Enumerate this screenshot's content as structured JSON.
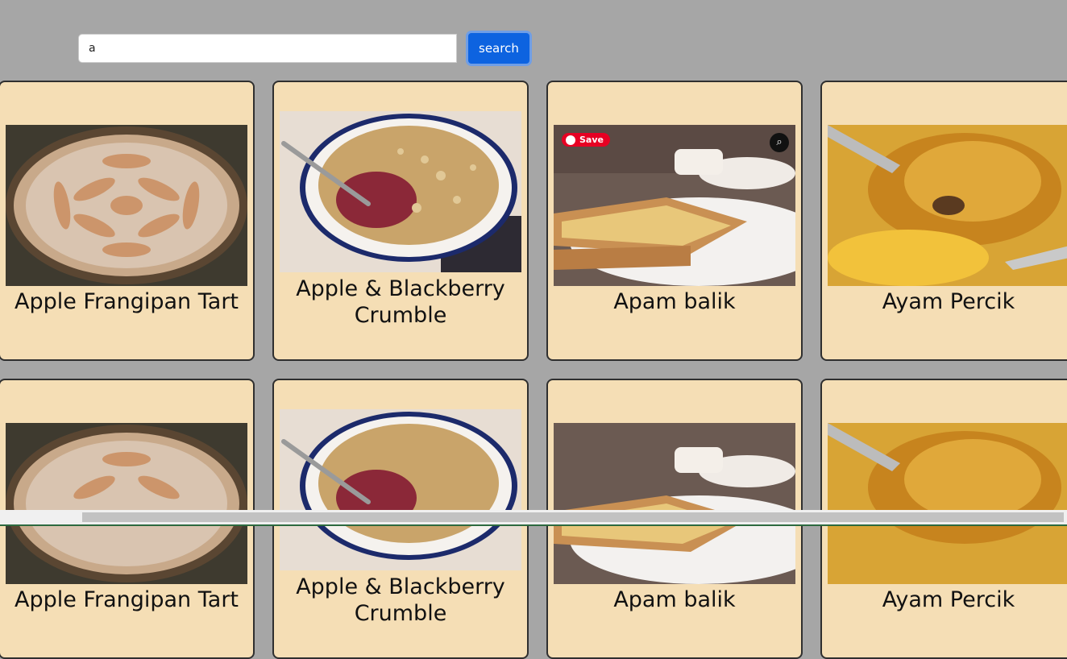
{
  "search": {
    "value": "a",
    "button_label": "search"
  },
  "recipes": [
    {
      "title": "Apple Frangipan Tart",
      "image": "apple-tart"
    },
    {
      "title": "Apple & Blackberry Crumble",
      "image": "crumble"
    },
    {
      "title": "Apam balik",
      "image": "apam-balik",
      "pin_save": "Save"
    },
    {
      "title": "Ayam Percik",
      "image": "ayam-percik"
    }
  ],
  "colors": {
    "page_bg": "#a6a6a6",
    "card_bg": "#f5deb5",
    "button_bg": "#0d63e0"
  }
}
